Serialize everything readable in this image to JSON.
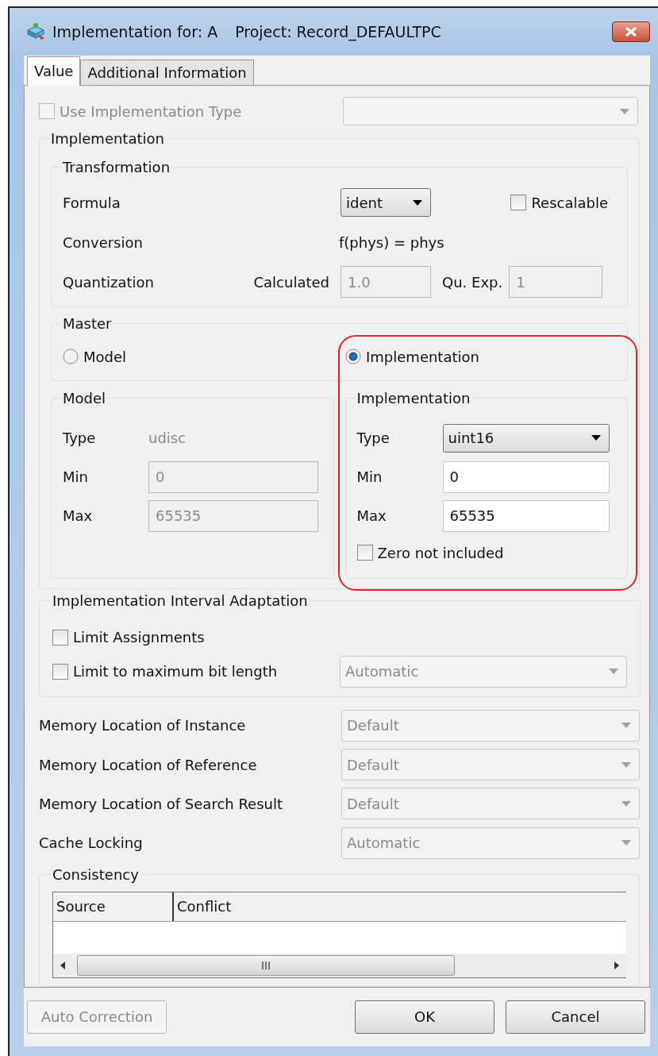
{
  "window": {
    "title": "Implementation for: A",
    "project": "Project: Record_DEFAULTPC"
  },
  "tabs": [
    {
      "label": "Value",
      "selected": true
    },
    {
      "label": "Additional Information",
      "selected": false
    }
  ],
  "use_implementation_type": {
    "label": "Use Implementation Type",
    "checked": false,
    "disabled": true
  },
  "implementation": {
    "title": "Implementation",
    "transformation": {
      "title": "Transformation",
      "formula_label": "Formula",
      "formula": "ident",
      "rescalable": {
        "label": "Rescalable",
        "checked": false
      },
      "conversion_label": "Conversion",
      "conversion": "f(phys) = phys",
      "quantization_label": "Quantization",
      "calculated_label": "Calculated",
      "calculated": "1.0",
      "qu_exp_label": "Qu. Exp.",
      "qu_exp": "1"
    },
    "master": {
      "title": "Master",
      "options": [
        {
          "label": "Model",
          "selected": false
        },
        {
          "label": "Implementation",
          "selected": true
        }
      ]
    },
    "model": {
      "title": "Model",
      "type_label": "Type",
      "type": "udisc",
      "min_label": "Min",
      "min": "0",
      "max_label": "Max",
      "max": "65535"
    },
    "impl": {
      "title": "Implementation",
      "type_label": "Type",
      "type": "uint16",
      "min_label": "Min",
      "min": "0",
      "max_label": "Max",
      "max": "65535",
      "zero": {
        "label": "Zero not included",
        "checked": false
      }
    }
  },
  "interval_adaptation": {
    "title": "Implementation Interval Adaptation",
    "limit_assignments": {
      "label": "Limit Assignments",
      "checked": false
    },
    "limit_bit_length": {
      "label": "Limit to maximum bit length",
      "checked": false,
      "value": "Automatic"
    }
  },
  "settings": [
    {
      "label": "Memory Location of Instance",
      "value": "Default"
    },
    {
      "label": "Memory Location of Reference",
      "value": "Default"
    },
    {
      "label": "Memory Location of Search Result",
      "value": "Default"
    },
    {
      "label": "Cache Locking",
      "value": "Automatic"
    }
  ],
  "consistency": {
    "title": "Consistency",
    "columns": [
      "Source",
      "Conflict"
    ]
  },
  "buttons": [
    {
      "label": "Auto Correction",
      "disabled": true
    },
    {
      "label": "OK",
      "disabled": false
    },
    {
      "label": "Cancel",
      "disabled": false
    }
  ]
}
